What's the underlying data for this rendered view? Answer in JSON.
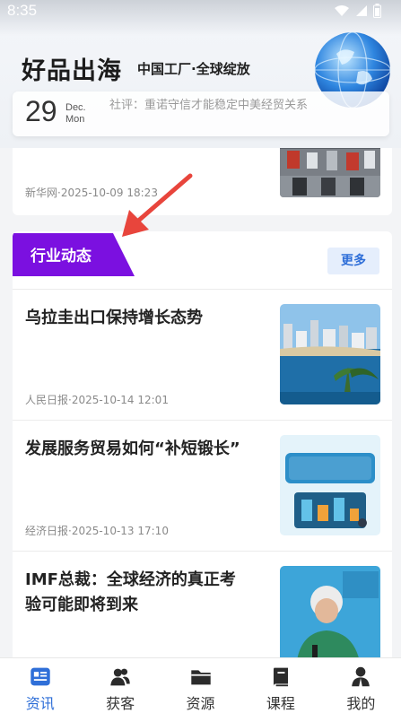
{
  "status": {
    "time": "8:35"
  },
  "header": {
    "brand": "好品出海",
    "slogan": "中国工厂·全球绽放",
    "date_day": "29",
    "date_month": "Dec.",
    "date_weekday": "Mon",
    "ticker": "社评：重诺守信才能稳定中美经贸关系"
  },
  "top_card": {
    "meta": "新华网·2025-10-09 18:23"
  },
  "section": {
    "title": "行业动态",
    "more_label": "更多",
    "items": [
      {
        "title": "乌拉圭出口保持增长态势",
        "meta": "人民日报·2025-10-14 12:01"
      },
      {
        "title": "发展服务贸易如何“补短锻长”",
        "meta": "经济日报·2025-10-13 17:10"
      },
      {
        "title": "IMF总裁：全球经济的真正考验可能即将到来",
        "meta": ""
      }
    ]
  },
  "nav": {
    "items": [
      {
        "label": "资讯",
        "icon": "news-icon",
        "active": true
      },
      {
        "label": "获客",
        "icon": "users-icon",
        "active": false
      },
      {
        "label": "资源",
        "icon": "folder-icon",
        "active": false
      },
      {
        "label": "课程",
        "icon": "book-icon",
        "active": false
      },
      {
        "label": "我的",
        "icon": "profile-icon",
        "active": false
      }
    ]
  },
  "colors": {
    "accent": "#2f6fd8",
    "section_tag": "#7b10e0",
    "annotation": "#e8453c"
  }
}
